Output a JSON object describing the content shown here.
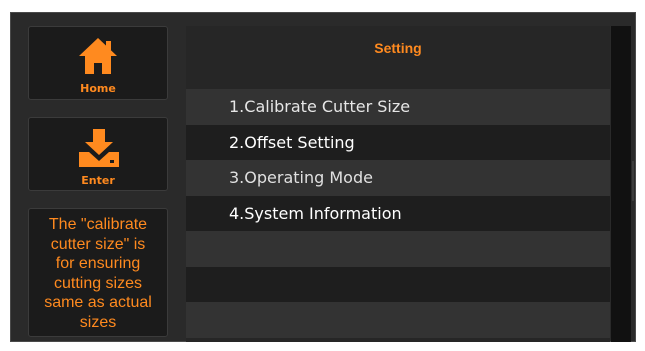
{
  "sidebar": {
    "home_label": "Home",
    "enter_label": "Enter",
    "help_text": [
      "The \"calibrate",
      "cutter size\" is",
      "for ensuring",
      "cutting sizes",
      "same as actual",
      "sizes"
    ]
  },
  "panel": {
    "title": "Setting",
    "items": [
      {
        "label": "1.Calibrate Cutter Size"
      },
      {
        "label": "2.Offset Setting"
      },
      {
        "label": "3.Operating Mode"
      },
      {
        "label": "4.System Information"
      }
    ]
  },
  "colors": {
    "accent": "#ff8a1f",
    "background": "#2a2a2a",
    "panel": "#262626"
  },
  "icons": {
    "home": "home-icon",
    "enter": "download-tray-icon"
  }
}
